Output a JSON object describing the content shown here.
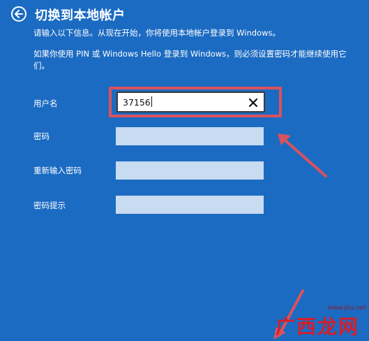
{
  "header": {
    "title": "切换到本地帐户"
  },
  "description": {
    "line1": "请输入以下信息。从现在开始，你将使用本地帐户登录到 Windows。",
    "line2": "如果你使用 PIN 或 Windows Hello 登录到 Windows，则必须设置密码才能继续使用它们。"
  },
  "form": {
    "username_label": "用户名",
    "username_value": "37156",
    "password_label": "密码",
    "reenter_password_label": "重新输入密码",
    "password_hint_label": "密码提示"
  },
  "watermark": {
    "text": "广西龙网",
    "url": "www.jbu.net"
  },
  "colors": {
    "background": "#1b6bc2",
    "field_empty": "#c7dbf1",
    "highlight": "#d9525e",
    "watermark": "#d31f2d"
  },
  "icons": {
    "back": "back-arrow-circle-icon",
    "clear": "close-icon"
  }
}
